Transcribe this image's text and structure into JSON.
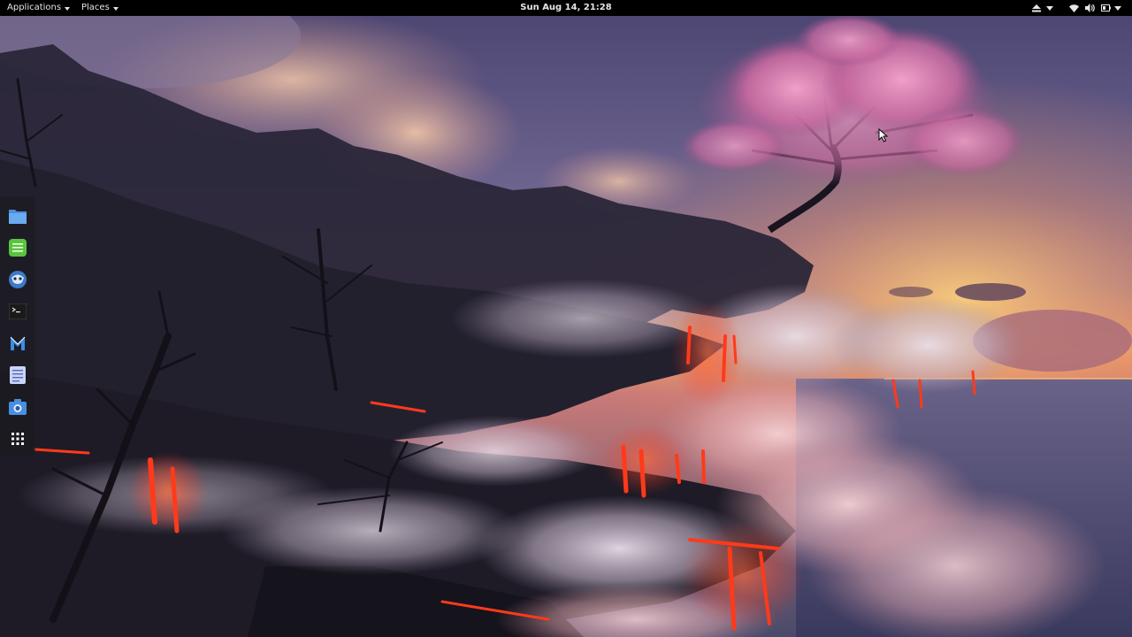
{
  "topbar": {
    "applications_label": "Applications",
    "places_label": "Places",
    "clock": "Sun Aug 14, 21:28",
    "tray_icons": [
      "eject-icon",
      "chevron-down-icon",
      "wifi-icon",
      "volume-icon",
      "battery-icon",
      "chevron-down-icon"
    ]
  },
  "dock": {
    "items": [
      {
        "icon": "files-icon",
        "app": "Files"
      },
      {
        "icon": "notes-icon",
        "app": "Notes"
      },
      {
        "icon": "browser-icon",
        "app": "Browser"
      },
      {
        "icon": "terminal-icon",
        "app": "Terminal"
      },
      {
        "icon": "mail-icon",
        "app": "Mail"
      },
      {
        "icon": "text-editor-icon",
        "app": "Text Editor"
      },
      {
        "icon": "screenshot-icon",
        "app": "Screenshot"
      },
      {
        "icon": "app-grid-icon",
        "app": "Show Applications"
      }
    ]
  },
  "colors": {
    "topbar_bg": "#000000",
    "topbar_text": "#e6e6e6",
    "dock_bg": "rgba(25,25,30,0.55)",
    "sky": "#6a5a8a",
    "sunset": "#f0a860",
    "lava": "#ff3a1a",
    "blossom": "#d87ab0"
  }
}
